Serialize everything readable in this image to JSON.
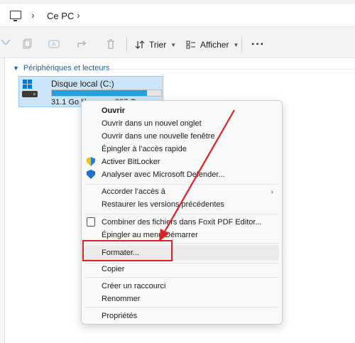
{
  "address_bar": {
    "icon": "computer-icon",
    "crumbs": [
      "Ce PC"
    ]
  },
  "toolbar": {
    "sort_label": "Trier",
    "view_label": "Afficher",
    "more_label": "···"
  },
  "section": {
    "title": "Périphériques et lecteurs"
  },
  "drive": {
    "name": "Disque local (C:)",
    "space_text": "31.1 Go libres sur 237 Go",
    "used_fraction": 0.87
  },
  "context_menu": {
    "items": [
      {
        "label": "Ouvrir"
      },
      {
        "label": "Ouvrir dans un nouvel onglet"
      },
      {
        "label": "Ouvrir dans une nouvelle fenêtre"
      },
      {
        "label": "Épingler à l’accès rapide"
      },
      {
        "label": "Activer BitLocker"
      },
      {
        "label": "Analyser avec Microsoft Defender..."
      },
      {
        "label": "Accorder l’accès à"
      },
      {
        "label": "Restaurer les versions précédentes"
      },
      {
        "label": "Combiner des fichiers dans Foxit PDF Editor..."
      },
      {
        "label": "Épingler au menu Démarrer"
      },
      {
        "label": "Formater..."
      },
      {
        "label": "Copier"
      },
      {
        "label": "Créer un raccourci"
      },
      {
        "label": "Renommer"
      },
      {
        "label": "Propriétés"
      }
    ]
  },
  "colors": {
    "highlight_box": "#e02020",
    "accent": "#0078d4"
  }
}
